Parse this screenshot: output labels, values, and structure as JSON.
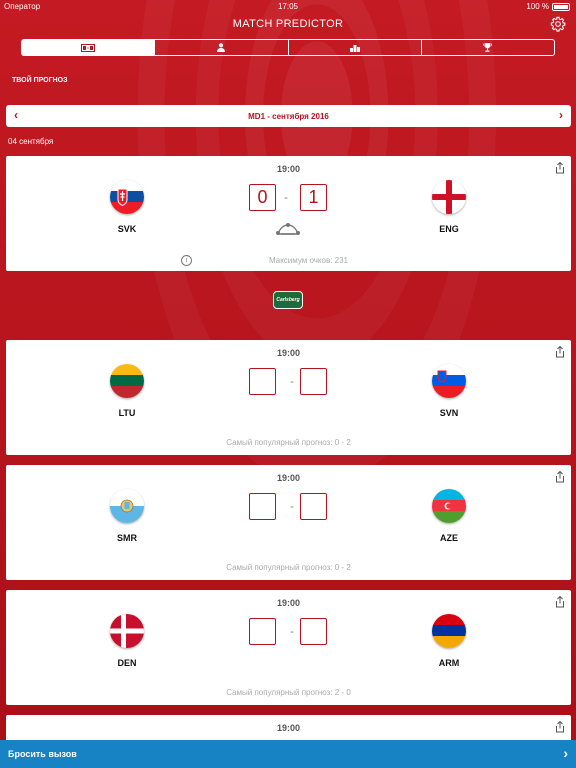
{
  "status": {
    "operator": "Оператор",
    "time": "17:05",
    "battery": "100 %"
  },
  "header": {
    "title": "MATCH PREDICTOR"
  },
  "section_label": "ТВОЙ ПРОГНОЗ",
  "daybar": {
    "label": "MD1 - сентября 2016"
  },
  "date": "04 сентября",
  "matches": [
    {
      "time": "19:00",
      "home": "SVK",
      "away": "ENG",
      "home_score": "0",
      "away_score": "1",
      "footer": "Максимум очков: 231"
    },
    {
      "time": "19:00",
      "home": "LTU",
      "away": "SVN",
      "home_score": "",
      "away_score": "",
      "footer": "Самый популярный прогноз: 0 - 2"
    },
    {
      "time": "19:00",
      "home": "SMR",
      "away": "AZE",
      "home_score": "",
      "away_score": "",
      "footer": "Самый популярный прогноз: 0 - 2"
    },
    {
      "time": "19:00",
      "home": "DEN",
      "away": "ARM",
      "home_score": "",
      "away_score": "",
      "footer": "Самый популярный прогноз: 2 - 0"
    },
    {
      "time": "19:00"
    }
  ],
  "dash": "-",
  "sponsor": "Carlsberg",
  "bottom": {
    "label": "Бросить вызов"
  }
}
